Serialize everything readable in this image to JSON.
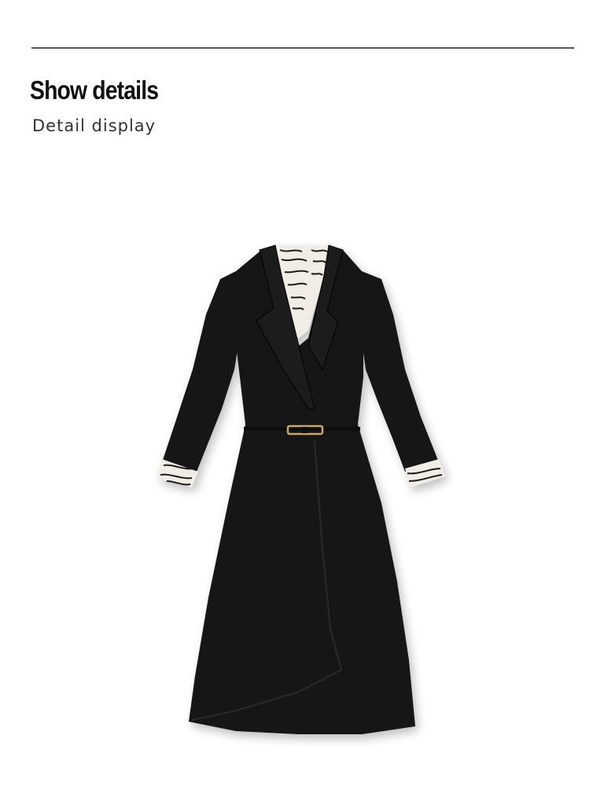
{
  "section": {
    "title": "Show details",
    "subtitle": "Detail display"
  },
  "product_image": {
    "subject": "black-belted-wrap-dress-icon",
    "colors": {
      "dress": "#141414",
      "trim": "#f1ede4",
      "stripe": "#1a1a1a",
      "buckle": "#c9a86a"
    }
  }
}
